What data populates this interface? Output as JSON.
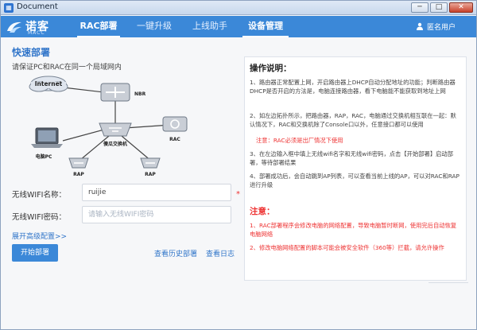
{
  "window": {
    "title": "Document",
    "controls": [
      "─",
      "□",
      "✕"
    ]
  },
  "logo": {
    "cn": "诺客",
    "en": "MACC"
  },
  "nav": {
    "tabs": [
      {
        "label": "RAC部署",
        "active": true
      },
      {
        "label": "一键升级",
        "active": false
      },
      {
        "label": "上线助手",
        "active": false
      },
      {
        "label": "设备管理",
        "active": true
      }
    ],
    "user": "匿名用户"
  },
  "quick_deploy": {
    "title": "快速部署",
    "subtitle": "请保证PC和RAC在同一个局域网内",
    "diagram": {
      "internet": "Internet",
      "nbr": "NBR",
      "pc": "电脑PC",
      "switch": "傻瓜交换机",
      "rac": "RAC",
      "ap1": "RAP",
      "ap2": "RAP"
    }
  },
  "form": {
    "ssid_label": "无线WIFI名称：",
    "ssid_value": "ruijie",
    "required_mark": "*",
    "password_label": "无线WIFI密码：",
    "password_placeholder": "请输入无线WIFI密码",
    "advanced": "展开高级配置>>",
    "start_button": "开始部署",
    "history_link": "查看历史部署",
    "log_link": "查看日志"
  },
  "instructions": {
    "title": "操作说明：",
    "step1": "1、路由器正常配置上网，开启路由器上DHCP自动分配地址的功能；判断路由器DHCP是否开启的方法是，电脑连接路由器，看下电脑能不能获取到地址上网",
    "step2": "2、如左边拓扑所示，把路由器，RAP，RAC，电脑通过交换机相互联在一起：默认情况下，RAC和交换机除了Console口以外，任意接口都可以使用",
    "step2_note": "注意：RAC必须是出厂情况下使用",
    "step3": "3、在左边输入框中填上无线wifi名字和无线wifi密码，点击【开始部署】启动部署，等待部署结果",
    "step4": "4、部署成功后，会自动跳到AP列表，可以查看当前上线的AP，可以对RAC和RAP进行升级",
    "attention_title": "注意：",
    "warn1": "1、RAC部署程序会修改电脑的网络配置，导致电脑暂时断网，使用完后自动恢复电脑网络",
    "warn2": "2、修改电脑网络配置的脚本可能会被安全软件（360等）拦截，请允许操作"
  }
}
